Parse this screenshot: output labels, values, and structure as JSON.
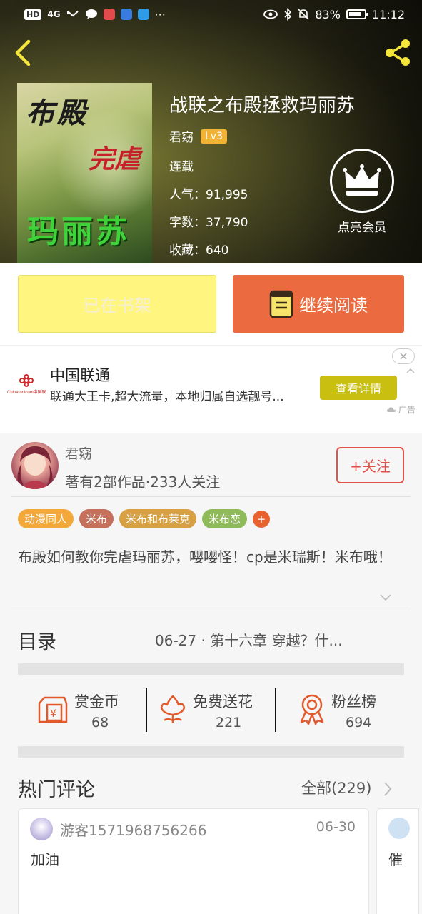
{
  "status_bar": {
    "left_badges": [
      "HD",
      "4G"
    ],
    "more": "···",
    "battery": "83%",
    "time": "11:12"
  },
  "book": {
    "title": "战联之布殿拯救玛丽苏",
    "author": "君窈",
    "level": "Lv3",
    "status": "连载",
    "popularity": "人气：91,995",
    "word_count": "字数：37,790",
    "favorites": "收藏：640",
    "cover_text": {
      "line1": "布殿",
      "line2": "完虐",
      "line3": "玛丽苏"
    }
  },
  "vip": {
    "label": "点亮会员"
  },
  "actions": {
    "shelf_label": "已在书架",
    "read_label": "继续阅读"
  },
  "ad": {
    "title": "中国联通",
    "desc": "联通大王卡,超大流量，本地归属自选靓号...",
    "button": "查看详情",
    "tag": "广告",
    "logo_text": "China unicom中国联通"
  },
  "author_card": {
    "name": "君窈",
    "stats": "著有2部作品·233人关注",
    "follow_label": "+关注"
  },
  "tags": [
    {
      "label": "动漫同人",
      "color": "#f3a93a"
    },
    {
      "label": "米布",
      "color": "#c4705a"
    },
    {
      "label": "米布和布莱克",
      "color": "#d6a043"
    },
    {
      "label": "米布恋",
      "color": "#8fba5a"
    }
  ],
  "tag_more": "+",
  "description": "布殿如何教你完虐玛丽苏，嘤嘤怪！cp是米瑞斯！米布哦！",
  "toc": {
    "label": "目录",
    "latest": "06-27 · 第十六章  穿越？什..."
  },
  "rewards": [
    {
      "label": "赏金币",
      "count": "68",
      "icon": "coin-envelope-icon"
    },
    {
      "label": "免费送花",
      "count": "221",
      "icon": "flower-icon"
    },
    {
      "label": "粉丝榜",
      "count": "694",
      "icon": "medal-icon"
    }
  ],
  "hot_comments": {
    "title": "热门评论",
    "all_label": "全部(229)",
    "items": [
      {
        "user": "游客1571968756266",
        "date": "06-30",
        "text": "加油"
      },
      {
        "text": "催"
      }
    ]
  },
  "colors": {
    "accent_orange": "#eb6a3f",
    "shelf_yellow": "#fff57f",
    "follow_red": "#e0524a",
    "ad_button": "#c8bf11"
  }
}
